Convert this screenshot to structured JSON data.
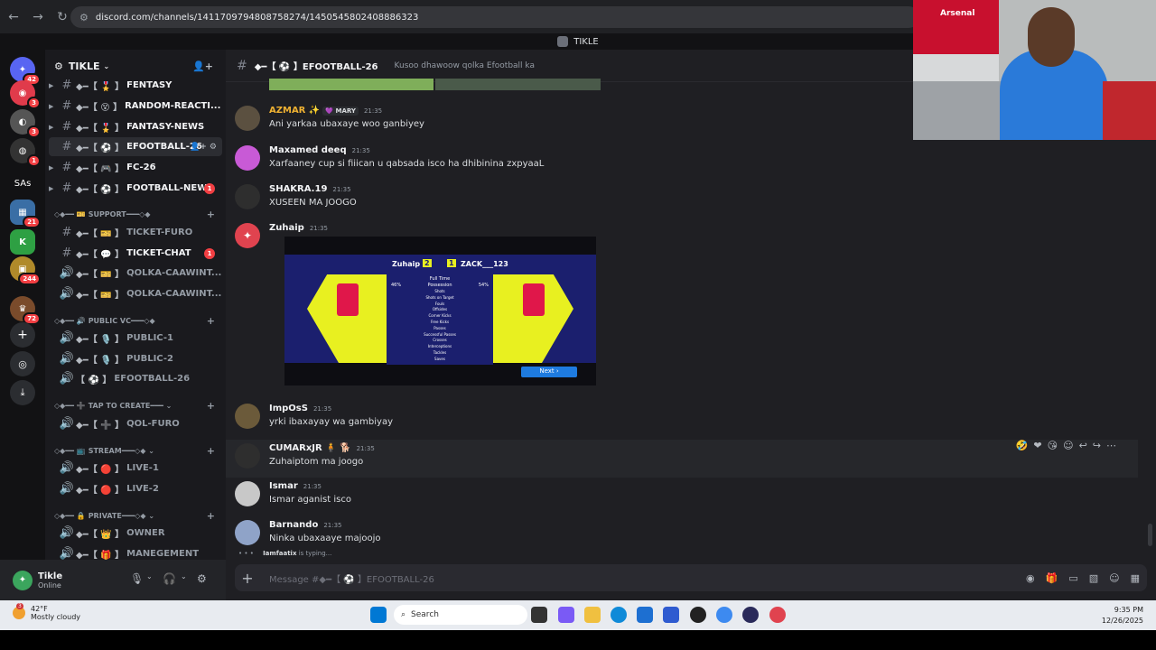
{
  "browser": {
    "url": "discord.com/channels/1411709794808758274/1450545802408886323"
  },
  "window": {
    "title": "TIKLE"
  },
  "server_rail": {
    "items": [
      {
        "name": "discord-home",
        "badge": "42"
      },
      {
        "name": "server-2",
        "badge": "3"
      },
      {
        "name": "server-3",
        "badge": "3"
      },
      {
        "name": "server-4",
        "badge": "1"
      },
      {
        "name": "server-sas",
        "label": "SAs"
      },
      {
        "name": "server-6",
        "badge": "21"
      },
      {
        "name": "server-kick",
        "label": "K"
      },
      {
        "name": "server-8",
        "badge": "244"
      },
      {
        "name": "server-9",
        "badge": "72"
      }
    ]
  },
  "guild": {
    "name": "TIKLE"
  },
  "channels": [
    {
      "prefix": "◆━【 🎖️ 】",
      "name": "FENTASY"
    },
    {
      "prefix": "◆━【 😵 】",
      "name": "RANDOM-REACTI..."
    },
    {
      "prefix": "◆━【 🎖️ 】",
      "name": "FANTASY-NEWS"
    },
    {
      "prefix": "◆━【 ⚽ 】",
      "name": "EFOOTBALL-26"
    },
    {
      "prefix": "◆━【 🎮 】",
      "name": "FC-26"
    },
    {
      "prefix": "◆━【 ⚽ 】",
      "name": "FOOTBALL-NEWS",
      "badge": "1"
    }
  ],
  "categories": {
    "support": "SUPPORT",
    "public_vc": "PUBLIC VC",
    "tap_to_create": "TAP TO CREATE",
    "stream": "STREAM",
    "private": "PRIVATE"
  },
  "support_channels": [
    {
      "prefix": "◆━【 🎫 】",
      "name": "TICKET-FURO"
    },
    {
      "prefix": "◆━【 💬 】",
      "name": "TICKET-CHAT",
      "badge": "1"
    },
    {
      "prefix": "◆━【 🎫 】",
      "name": "QOLKA-CAAWINT..."
    },
    {
      "prefix": "◆━【 🎫 】",
      "name": "QOLKA-CAAWINT..."
    }
  ],
  "voice_public": [
    {
      "prefix": "◆━【 🎙️ 】",
      "name": "PUBLIC-1"
    },
    {
      "prefix": "◆━【 🎙️ 】",
      "name": "PUBLIC-2"
    },
    {
      "prefix": "【 ⚽ 】",
      "name": "EFOOTBALL-26"
    }
  ],
  "voice_create": [
    {
      "prefix": "◆━【 ➕ 】",
      "name": "QOL-FURO"
    }
  ],
  "voice_stream": [
    {
      "prefix": "◆━【 🔴 】",
      "name": "LIVE-1"
    },
    {
      "prefix": "◆━【 🔴 】",
      "name": "LIVE-2"
    }
  ],
  "voice_private": [
    {
      "prefix": "◆━【 👑 】",
      "name": "OWNER"
    },
    {
      "prefix": "◆━【 🎁 】",
      "name": "MANEGEMENT"
    }
  ],
  "user": {
    "name": "Tikle",
    "status": "Online"
  },
  "channel_header": {
    "name": "◆━【 ⚽ 】EFOOTBALL-26",
    "topic": "Kusoo dhawoow qolka Efootball ka"
  },
  "messages": [
    {
      "author": "AZMAR ✨",
      "tag": "💜 MARY",
      "time": "21:35",
      "text": "Ani yarkaa ubaxaye woo ganbiyey",
      "author_color": "#f0b232"
    },
    {
      "author": "Maxamed deeq",
      "time": "21:35",
      "text": "Xarfaaney cup si fiiican u qabsada  isco ha dhibinina zxpyaaL"
    },
    {
      "author": "SHAKRA.19",
      "time": "21:35",
      "text": "XUSEEN MA JOOGO"
    },
    {
      "author": "Zuhaip",
      "time": "21:35",
      "text": ""
    },
    {
      "author": "ImpOsS",
      "time": "21:35",
      "text": "yrki ibaxayay wa gambiyay"
    },
    {
      "author": "CUMARxJR 🧍 🐕",
      "time": "21:35",
      "text": "Zuhaiptom ma joogo"
    },
    {
      "author": "Ismar",
      "time": "21:35",
      "text": "Ismar aganist isco"
    },
    {
      "author": "Barnando",
      "time": "21:35",
      "text": "Ninka ubaxaaye majoojo"
    }
  ],
  "embed": {
    "home": "Zuhaip",
    "home_score": "2",
    "away_score": "1",
    "away": "ZACK___123",
    "subtitle": "Full Time",
    "possession": [
      "46%",
      "Possession",
      "54%"
    ],
    "stats": [
      "Shots",
      "Shots on Target",
      "Fouls",
      "Offsides",
      "Corner Kicks",
      "Free Kicks",
      "Passes",
      "Successful Passes",
      "Crosses",
      "Interceptions",
      "Tackles",
      "Saves"
    ],
    "next": "Next"
  },
  "typing": {
    "user": "Iamfaatix",
    "text": "is typing..."
  },
  "composer": {
    "placeholder": "Message #◆━【 ⚽ 】EFOOTBALL-26"
  },
  "taskbar": {
    "weather_temp": "42°F",
    "weather_desc": "Mostly cloudy",
    "weather_badge": "3",
    "search": "Search",
    "time": "9:35 PM",
    "date": "12/26/2025"
  },
  "webcam": {
    "sign": "Arsenal"
  }
}
